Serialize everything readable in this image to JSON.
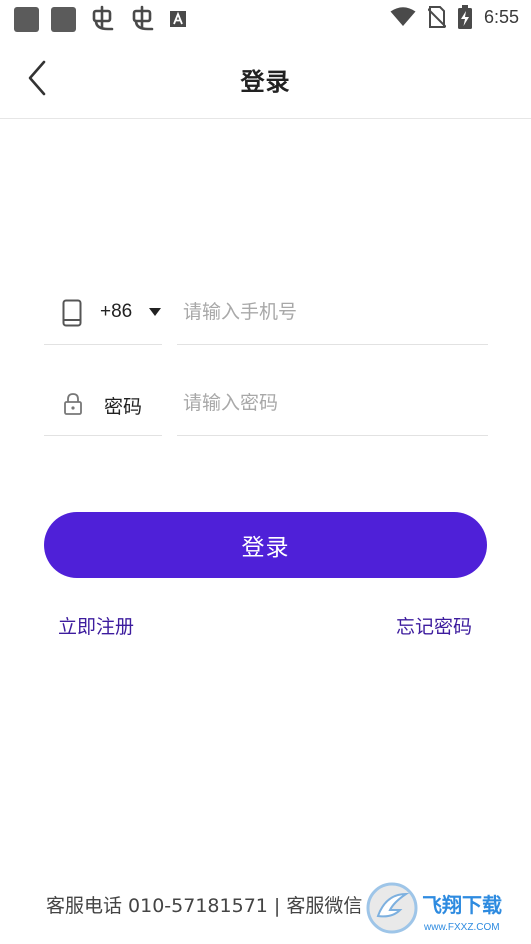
{
  "status_bar": {
    "time": "6:55",
    "icons": [
      "app-square-icon",
      "app-square-icon",
      "bug-icon",
      "bug-icon",
      "a-font-icon",
      "wifi-icon",
      "no-sim-icon",
      "battery-charging-icon"
    ]
  },
  "nav": {
    "title": "登录",
    "back_icon": "chevron-left-icon"
  },
  "form": {
    "country_code": "+86",
    "phone_placeholder": "请输入手机号",
    "phone_value": "",
    "password_label": "密码",
    "password_placeholder": "请输入密码",
    "password_value": ""
  },
  "actions": {
    "login_label": "登录",
    "register_label": "立即注册",
    "forgot_label": "忘记密码"
  },
  "footer": {
    "text": "客服电话 010-57181571 | 客服微信"
  },
  "watermark": {
    "text": "飞翔下载",
    "url_text": "www.FXXZ.COM"
  },
  "colors": {
    "accent": "#4f20d8",
    "link": "#3d1c9e",
    "placeholder": "#a8a8a8"
  }
}
